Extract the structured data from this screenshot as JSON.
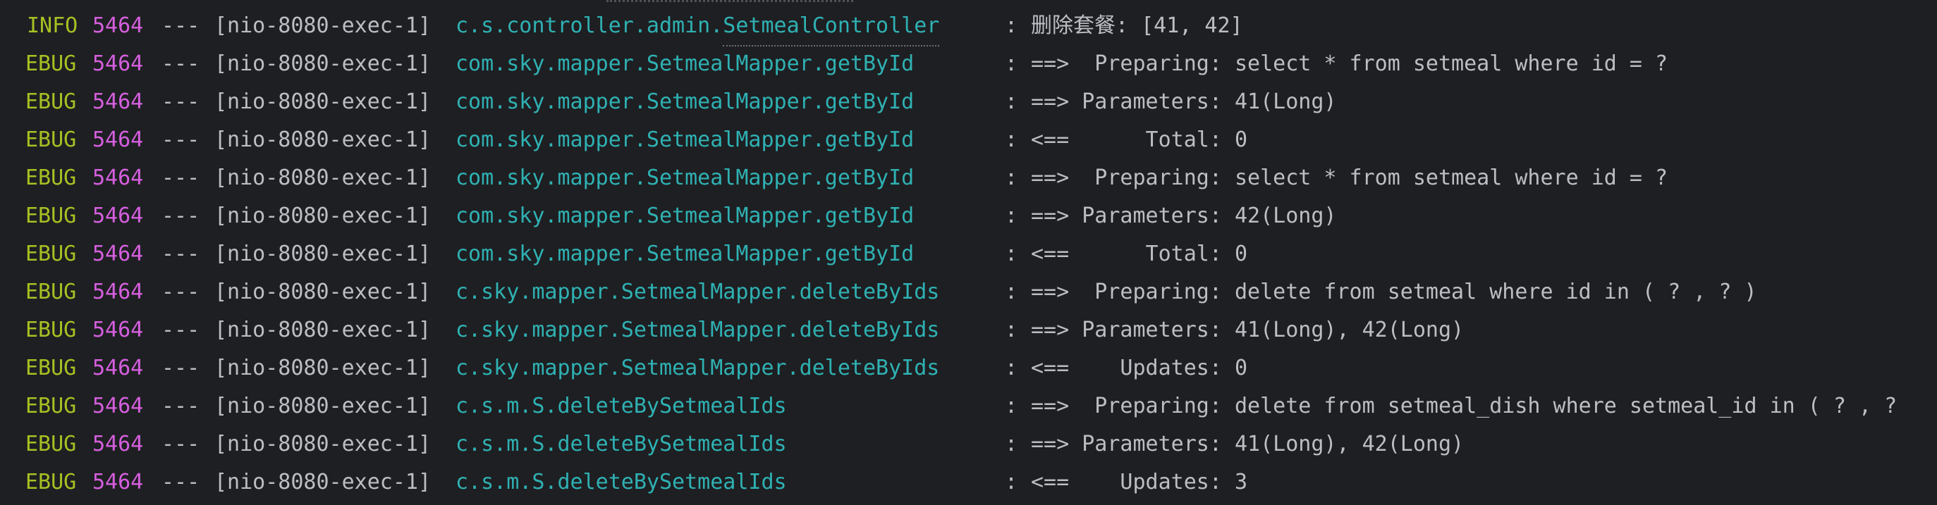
{
  "console": {
    "lines": [
      {
        "level": "INFO",
        "pid": "5464",
        "sep": "---",
        "thread": "[nio-8080-exec-1]",
        "logger_prefix": "c.s.controller.admin.",
        "logger_class": "SetmealController",
        "colon": ":",
        "message": "删除套餐: [41, 42]"
      },
      {
        "level": "EBUG",
        "pid": "5464",
        "sep": "---",
        "thread": "[nio-8080-exec-1]",
        "logger_prefix": "com.sky.mapper.SetmealMapper.getById",
        "logger_class": "",
        "colon": ":",
        "message": "==>  Preparing: select * from setmeal where id = ?"
      },
      {
        "level": "EBUG",
        "pid": "5464",
        "sep": "---",
        "thread": "[nio-8080-exec-1]",
        "logger_prefix": "com.sky.mapper.SetmealMapper.getById",
        "logger_class": "",
        "colon": ":",
        "message": "==> Parameters: 41(Long)"
      },
      {
        "level": "EBUG",
        "pid": "5464",
        "sep": "---",
        "thread": "[nio-8080-exec-1]",
        "logger_prefix": "com.sky.mapper.SetmealMapper.getById",
        "logger_class": "",
        "colon": ":",
        "message": "<==      Total: 0"
      },
      {
        "level": "EBUG",
        "pid": "5464",
        "sep": "---",
        "thread": "[nio-8080-exec-1]",
        "logger_prefix": "com.sky.mapper.SetmealMapper.getById",
        "logger_class": "",
        "colon": ":",
        "message": "==>  Preparing: select * from setmeal where id = ?"
      },
      {
        "level": "EBUG",
        "pid": "5464",
        "sep": "---",
        "thread": "[nio-8080-exec-1]",
        "logger_prefix": "com.sky.mapper.SetmealMapper.getById",
        "logger_class": "",
        "colon": ":",
        "message": "==> Parameters: 42(Long)"
      },
      {
        "level": "EBUG",
        "pid": "5464",
        "sep": "---",
        "thread": "[nio-8080-exec-1]",
        "logger_prefix": "com.sky.mapper.SetmealMapper.getById",
        "logger_class": "",
        "colon": ":",
        "message": "<==      Total: 0"
      },
      {
        "level": "EBUG",
        "pid": "5464",
        "sep": "---",
        "thread": "[nio-8080-exec-1]",
        "logger_prefix": "c.sky.mapper.SetmealMapper.deleteByIds",
        "logger_class": "",
        "colon": ":",
        "message": "==>  Preparing: delete from setmeal where id in ( ? , ? )"
      },
      {
        "level": "EBUG",
        "pid": "5464",
        "sep": "---",
        "thread": "[nio-8080-exec-1]",
        "logger_prefix": "c.sky.mapper.SetmealMapper.deleteByIds",
        "logger_class": "",
        "colon": ":",
        "message": "==> Parameters: 41(Long), 42(Long)"
      },
      {
        "level": "EBUG",
        "pid": "5464",
        "sep": "---",
        "thread": "[nio-8080-exec-1]",
        "logger_prefix": "c.sky.mapper.SetmealMapper.deleteByIds",
        "logger_class": "",
        "colon": ":",
        "message": "<==    Updates: 0"
      },
      {
        "level": "EBUG",
        "pid": "5464",
        "sep": "---",
        "thread": "[nio-8080-exec-1]",
        "logger_prefix": "c.s.m.S.deleteBySetmealIds",
        "logger_class": "",
        "colon": ":",
        "message": "==>  Preparing: delete from setmeal_dish where setmeal_id in ( ? , ?"
      },
      {
        "level": "EBUG",
        "pid": "5464",
        "sep": "---",
        "thread": "[nio-8080-exec-1]",
        "logger_prefix": "c.s.m.S.deleteBySetmealIds",
        "logger_class": "",
        "colon": ":",
        "message": "==> Parameters: 41(Long), 42(Long)"
      },
      {
        "level": "EBUG",
        "pid": "5464",
        "sep": "---",
        "thread": "[nio-8080-exec-1]",
        "logger_prefix": "c.s.m.S.deleteBySetmealIds",
        "logger_class": "",
        "colon": ":",
        "message": "<==    Updates: 3"
      }
    ]
  },
  "colors": {
    "background": "#1e1f22",
    "level": "#a8c023",
    "pid": "#d55fde",
    "logger": "#2fb1b3",
    "text": "#bcbec4"
  }
}
